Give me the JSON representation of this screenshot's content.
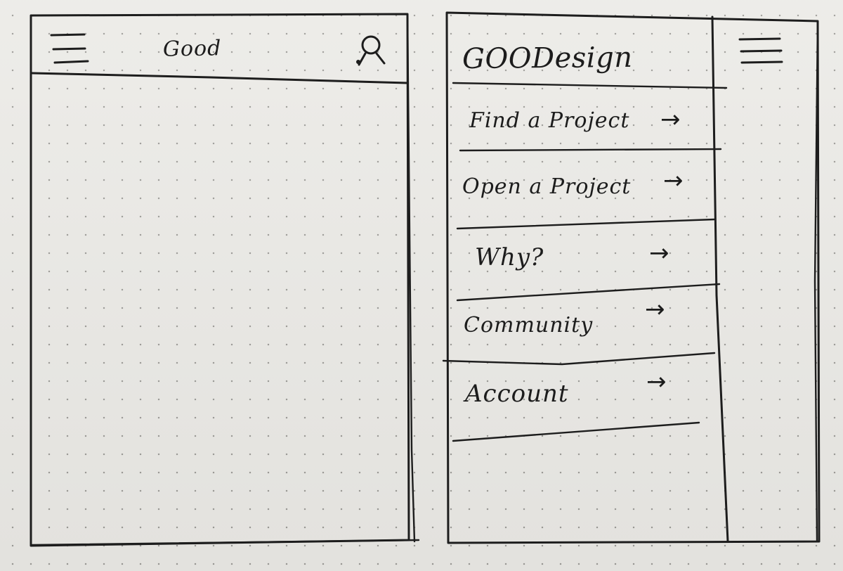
{
  "screens": [
    {
      "header": {
        "menu_icon": "hamburger-icon",
        "title": "Good",
        "profile_icon": "user-icon"
      }
    },
    {
      "brand": "GOODesign",
      "drawer_icon": "hamburger-icon",
      "menu_items": [
        {
          "label": "Find a Project",
          "icon": "arrow-right-icon",
          "arrow": "→"
        },
        {
          "label": "Open a Project",
          "icon": "arrow-right-icon",
          "arrow": "→"
        },
        {
          "label": "Why?",
          "icon": "arrow-right-icon",
          "arrow": "→"
        },
        {
          "label": "Community",
          "icon": "arrow-right-icon",
          "arrow": "→"
        },
        {
          "label": "Account",
          "icon": "arrow-right-icon",
          "arrow": "→"
        }
      ]
    }
  ],
  "colors": {
    "ink": "#1d1d1d",
    "paper": "#ecebe7",
    "dot": "#9e9d99"
  }
}
